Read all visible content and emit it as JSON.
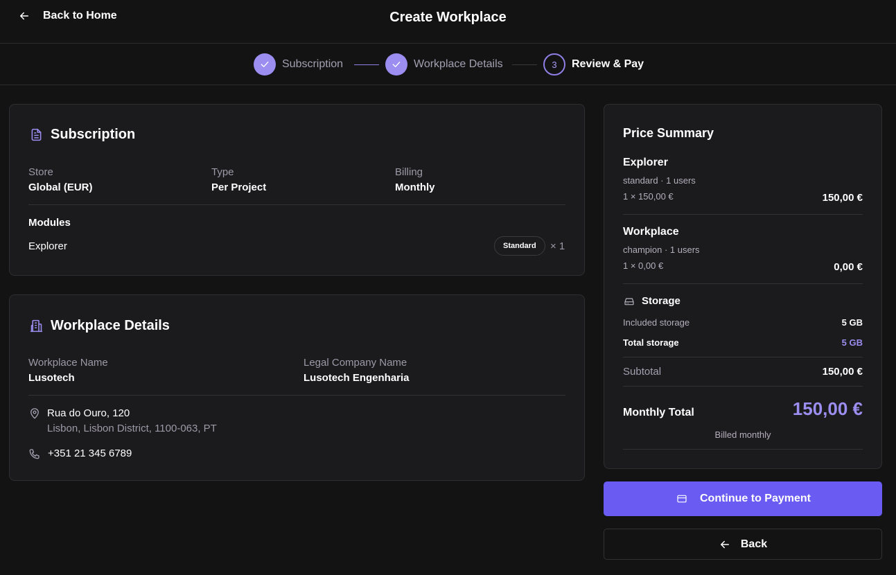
{
  "header": {
    "back_label": "Back to Home",
    "title": "Create Workplace"
  },
  "stepper": {
    "steps": [
      {
        "label": "Subscription",
        "state": "done"
      },
      {
        "label": "Workplace Details",
        "state": "done"
      },
      {
        "label": "Review & Pay",
        "state": "current",
        "number": "3"
      }
    ]
  },
  "subscription": {
    "title": "Subscription",
    "store_label": "Store",
    "store_value": "Global (EUR)",
    "type_label": "Type",
    "type_value": "Per Project",
    "billing_label": "Billing",
    "billing_value": "Monthly",
    "modules_label": "Modules",
    "modules": [
      {
        "name": "Explorer",
        "badge": "Standard",
        "quantity": "× 1"
      }
    ]
  },
  "workplace": {
    "title": "Workplace Details",
    "name_label": "Workplace Name",
    "name_value": "Lusotech",
    "legal_label": "Legal Company Name",
    "legal_value": "Lusotech Engenharia",
    "address_line1": "Rua do Ouro, 120",
    "address_line2": "Lisbon, Lisbon District, 1100-063, PT",
    "phone": "+351 21 345 6789"
  },
  "price_summary": {
    "title": "Price Summary",
    "items": [
      {
        "name": "Explorer",
        "detail": "standard · 1 users",
        "calc": "1 × 150,00 €",
        "amount": "150,00 €"
      },
      {
        "name": "Workplace",
        "detail": "champion · 1 users",
        "calc": "1 × 0,00 €",
        "amount": "0,00 €"
      }
    ],
    "storage_title": "Storage",
    "included_storage_label": "Included storage",
    "included_storage_value": "5 GB",
    "total_storage_label": "Total storage",
    "total_storage_value": "5 GB",
    "subtotal_label": "Subtotal",
    "subtotal_value": "150,00 €",
    "monthly_total_label": "Monthly Total",
    "monthly_total_value": "150,00 €",
    "billed_note": "Billed monthly"
  },
  "actions": {
    "continue_label": "Continue to Payment",
    "back_label": "Back"
  },
  "colors": {
    "accent": "#6a5cf2",
    "accent_light": "#9b8ef0",
    "background": "#141314",
    "card": "#1b1a1c"
  }
}
